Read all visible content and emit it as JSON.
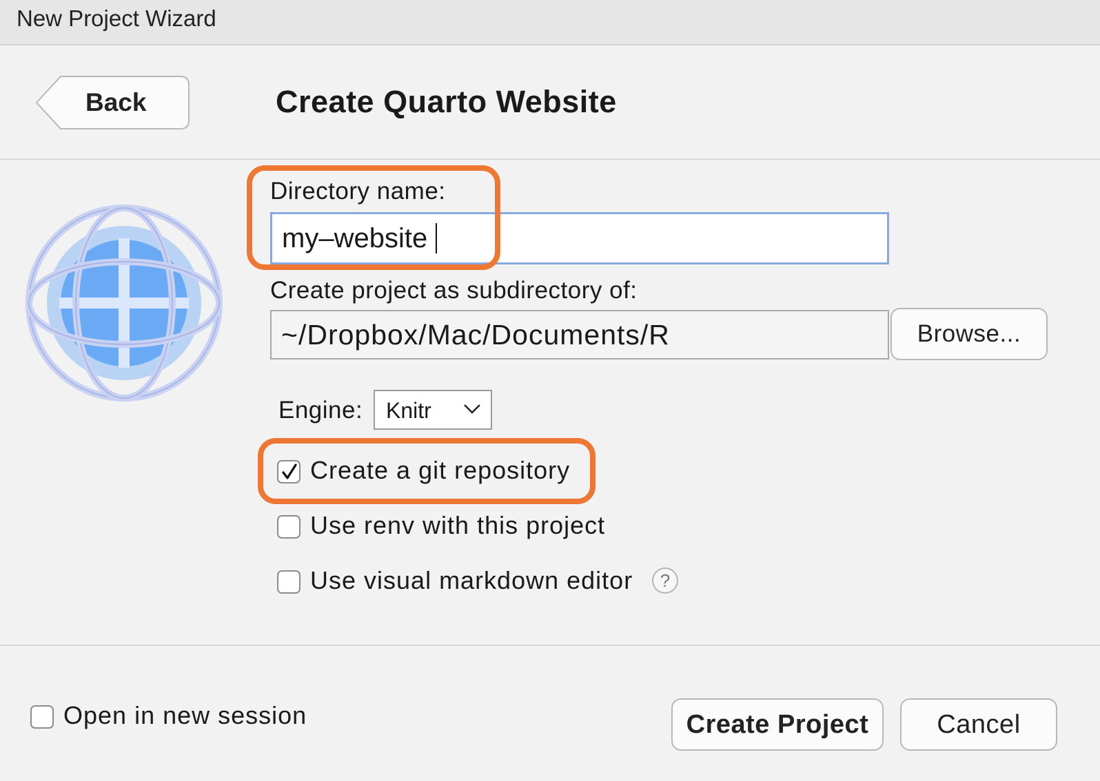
{
  "window": {
    "title": "New Project Wizard"
  },
  "header": {
    "back_label": "Back",
    "page_title": "Create Quarto Website"
  },
  "form": {
    "directory_label": "Directory name:",
    "directory_value": "my–website",
    "parent_label": "Create project as subdirectory of:",
    "parent_value": "~/Dropbox/Mac/Documents/R",
    "browse_label": "Browse...",
    "engine_label": "Engine:",
    "engine_value": "Knitr",
    "options": [
      {
        "label": "Create a git repository",
        "checked": true
      },
      {
        "label": "Use renv with this project",
        "checked": false
      },
      {
        "label": "Use visual markdown editor",
        "checked": false
      }
    ],
    "help_glyph": "?"
  },
  "footer": {
    "open_session_label": "Open in new session",
    "open_session_checked": false,
    "create_label": "Create Project",
    "cancel_label": "Cancel"
  },
  "colors": {
    "highlight": "#ee7733",
    "focus_border": "#8aa8dc",
    "globe_blue": "#6aa9f4"
  }
}
